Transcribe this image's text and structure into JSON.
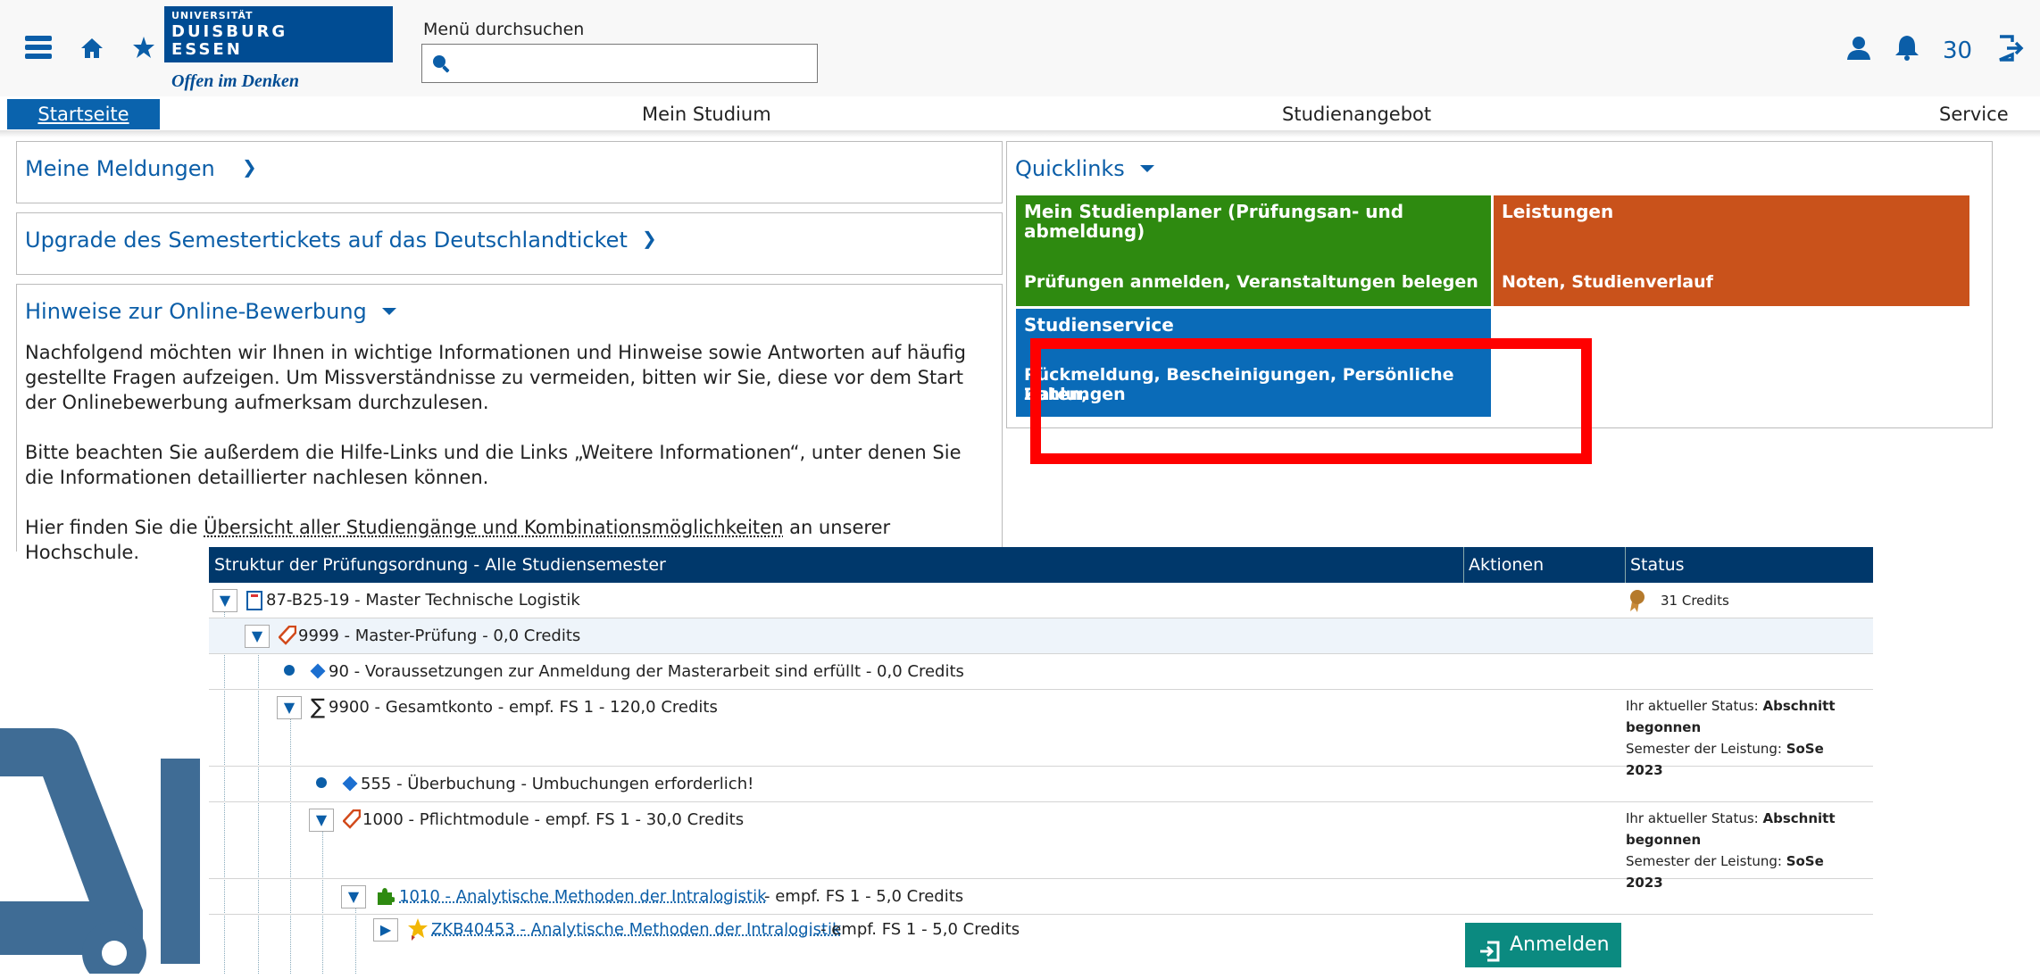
{
  "header": {
    "logo": {
      "line1": "UNIVERSITÄT",
      "line2": "DUISBURG",
      "line3": "ESSEN",
      "slogan": "Offen im Denken"
    },
    "search": {
      "label": "Menü durchsuchen",
      "value": ""
    },
    "notification_count": "30",
    "icons": [
      "menu-icon",
      "home-icon",
      "star-icon",
      "user-icon",
      "bell-icon",
      "logout-icon"
    ]
  },
  "nav": {
    "tabs": [
      {
        "label": "Startseite",
        "active": true
      },
      {
        "label": "Mein Studium"
      },
      {
        "label": "Studienangebot"
      },
      {
        "label": "Service"
      }
    ]
  },
  "left": {
    "meldungen": "Meine Meldungen",
    "upgrade": "Upgrade des Semestertickets auf das Deutschlandticket",
    "hinweise_title": "Hinweise zur Online-Bewerbung",
    "para1": "Nachfolgend möchten wir Ihnen in wichtige Informationen und Hinweise sowie Antworten auf häufig gestellte Fragen aufzeigen. Um Missverständnisse zu vermeiden, bitten wir Sie, diese vor dem Start der Onlinebewerbung aufmerksam durchzulesen.",
    "para2": "Bitte beachten Sie außerdem die Hilfe-Links und die Links „Weitere Informationen“, unter denen Sie die Informationen detaillierter nachlesen können.",
    "para3_pre": "Hier finden Sie die",
    "para3_link": "Übersicht aller Studiengänge und Kombinationsmöglichkeiten",
    "para3_post": "an unserer Hochschule."
  },
  "quicklinks": {
    "title": "Quicklinks",
    "tiles": [
      {
        "title": "Mein Studienplaner (Prüfungsan- und abmeldung)",
        "sub": "Prüfungen anmelden, Veranstaltungen belegen",
        "color": "#2e8a10"
      },
      {
        "title": "Leistungen",
        "sub": "Noten, Studienverlauf",
        "color": "#c9521b"
      },
      {
        "title": "Studienservice",
        "sub_line1": "Rückmeldung, Bescheinigungen, Persönliche Daten,",
        "sub_line2": "Zahlungen",
        "color": "#0a6bb8"
      }
    ]
  },
  "table": {
    "headers": {
      "structure": "Struktur der Prüfungsordnung - Alle Studiensemester",
      "actions": "Aktionen",
      "status": "Status"
    },
    "rows": {
      "r1": {
        "text": "87-B25-19 - Master Technische Logistik",
        "status": "31 Credits"
      },
      "r2": {
        "text": "9999 - Master-Prüfung - 0,0 Credits"
      },
      "r3": {
        "text": "90 - Voraussetzungen zur Anmeldung der Masterarbeit sind erfüllt - 0,0 Credits"
      },
      "r4": {
        "text": "9900 - Gesamtkonto - empf. FS 1 - 120,0 Credits",
        "status_label": "Ihr aktueller Status:",
        "status_value_1": "Abschnitt",
        "status_value_2": "begonnen",
        "sem_label": "Semester der Leistung:",
        "sem_value": "SoSe 2023"
      },
      "r5": {
        "text": "555 - Überbuchung - Umbuchungen erforderlich!"
      },
      "r6": {
        "text": "1000 - Pflichtmodule - empf. FS 1 - 30,0 Credits",
        "status_label": "Ihr aktueller Status:",
        "status_value_1": "Abschnitt",
        "status_value_2": "begonnen",
        "sem_label": "Semester der Leistung:",
        "sem_value": "SoSe 2023"
      },
      "r7": {
        "link": "1010 - Analytische Methoden der Intralogistik",
        "text": "- empf. FS 1 - 5,0 Credits"
      },
      "r8": {
        "link": "ZKB40453 - Analytische Methoden der Intralogistik",
        "text": "- empf. FS 1 - 5,0 Credits"
      }
    },
    "anmelden_button": "Anmelden"
  }
}
